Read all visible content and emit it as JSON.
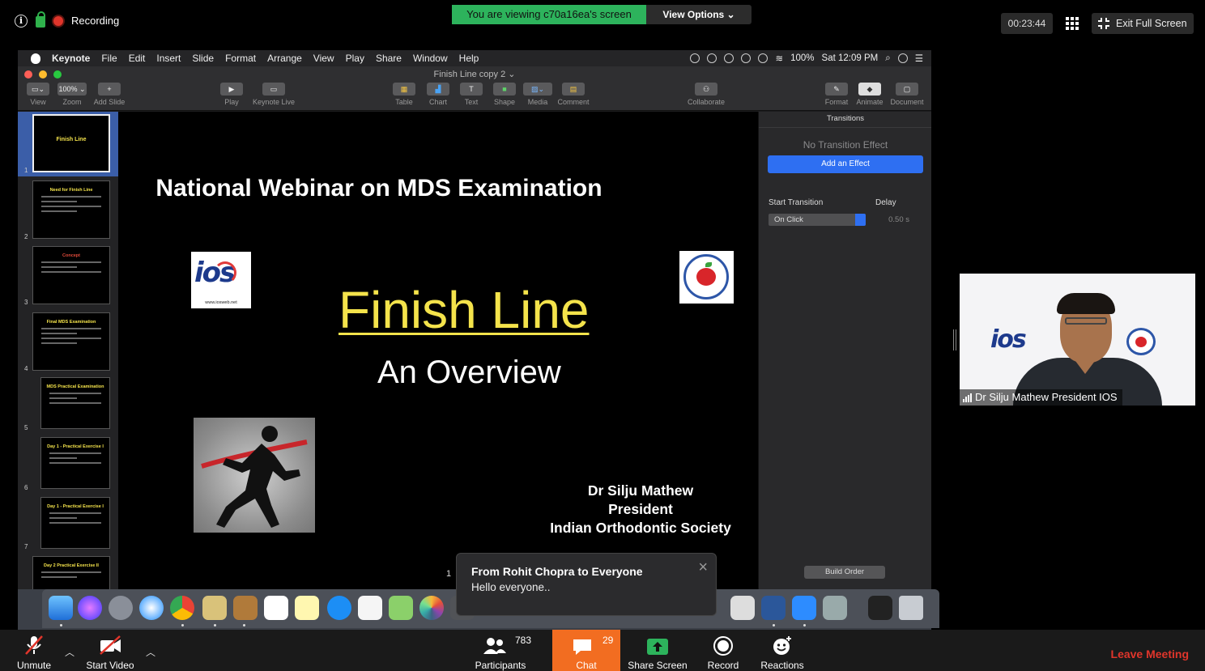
{
  "zoom_top": {
    "recording_label": "Recording",
    "viewing_banner": "You are viewing c70a16ea's screen",
    "view_options": "View Options ⌄",
    "timer": "00:23:44",
    "exit_full_screen": "Exit Full Screen"
  },
  "mac_menubar": {
    "items": [
      "Keynote",
      "File",
      "Edit",
      "Insert",
      "Slide",
      "Format",
      "Arrange",
      "View",
      "Play",
      "Share",
      "Window",
      "Help"
    ],
    "battery": "100%",
    "clock": "Sat 12:09 PM"
  },
  "keynote": {
    "window_title": "Finish Line copy 2 ⌄",
    "toolbar": {
      "view": "View",
      "zoom": "Zoom",
      "zoom_value": "100% ⌄",
      "add_slide": "Add Slide",
      "play": "Play",
      "keynote_live": "Keynote Live",
      "table": "Table",
      "chart": "Chart",
      "text": "Text",
      "shape": "Shape",
      "media": "Media",
      "comment": "Comment",
      "collaborate": "Collaborate",
      "format": "Format",
      "animate": "Animate",
      "document": "Document"
    },
    "navigator": {
      "thumbs": [
        {
          "num": "1",
          "title": "Finish Line"
        },
        {
          "num": "2",
          "title": "Need for Finish Line"
        },
        {
          "num": "3",
          "title": "Concept"
        },
        {
          "num": "4",
          "title": "Final MDS Examination"
        },
        {
          "num": "5",
          "title": "MDS Practical Examination"
        },
        {
          "num": "6",
          "title": "Day 1 - Practical Exercise I"
        },
        {
          "num": "7",
          "title": "Day 1 - Practical Exercise I"
        },
        {
          "num": "",
          "title": "Day 2 Practical Exercise II"
        }
      ]
    },
    "slide": {
      "heading": "National Webinar on MDS Examination",
      "ios_logo_text": "ios",
      "ios_url": "www.iosweb.net",
      "title": "Finish Line",
      "subtitle": "An Overview",
      "author_lines": [
        "Dr Silju Mathew",
        "President",
        "Indian Orthodontic Society"
      ],
      "slide_number": "1"
    },
    "inspector": {
      "tab": "Transitions",
      "no_transition": "No Transition Effect",
      "add_effect": "Add an Effect",
      "start_label": "Start Transition",
      "delay_label": "Delay",
      "start_value": "On Click",
      "delay_value": "0.50 s",
      "build_order": "Build Order"
    }
  },
  "chat_popup": {
    "from": "From Rohit Chopra to Everyone",
    "message": "Hello everyone.."
  },
  "video_tile": {
    "logo_text": "ios",
    "name": "Dr Silju Mathew President IOS"
  },
  "zoom_bottom": {
    "unmute": "Unmute",
    "start_video": "Start Video",
    "participants": "Participants",
    "participants_count": "783",
    "chat": "Chat",
    "chat_count": "29",
    "share_screen": "Share Screen",
    "record": "Record",
    "reactions": "Reactions",
    "leave": "Leave Meeting"
  },
  "colors": {
    "zoom_green": "#2db35c",
    "zoom_orange": "#f26d21",
    "leave_red": "#e0352b",
    "keynote_blue": "#2e6ff2",
    "slide_title_yellow": "#f4e34b"
  }
}
